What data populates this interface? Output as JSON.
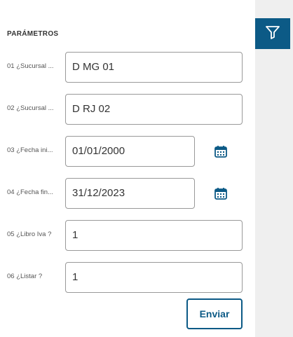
{
  "section_title": "PARÁMETROS",
  "params": [
    {
      "label": "01 ¿Sucursal ...",
      "value": "D MG 01"
    },
    {
      "label": "02 ¿Sucursal ...",
      "value": "D RJ 02"
    },
    {
      "label": "03 ¿Fecha ini...",
      "value": "01/01/2000"
    },
    {
      "label": "04 ¿Fecha fin...",
      "value": "31/12/2023"
    },
    {
      "label": "05 ¿Libro Iva ?",
      "value": "1"
    },
    {
      "label": "06 ¿Listar ?",
      "value": "1"
    }
  ],
  "send_label": "Enviar",
  "icons": {
    "filter": "filter-icon",
    "calendar": "calendar-icon"
  },
  "colors": {
    "accent": "#0c5a86",
    "rail": "#efefef"
  }
}
